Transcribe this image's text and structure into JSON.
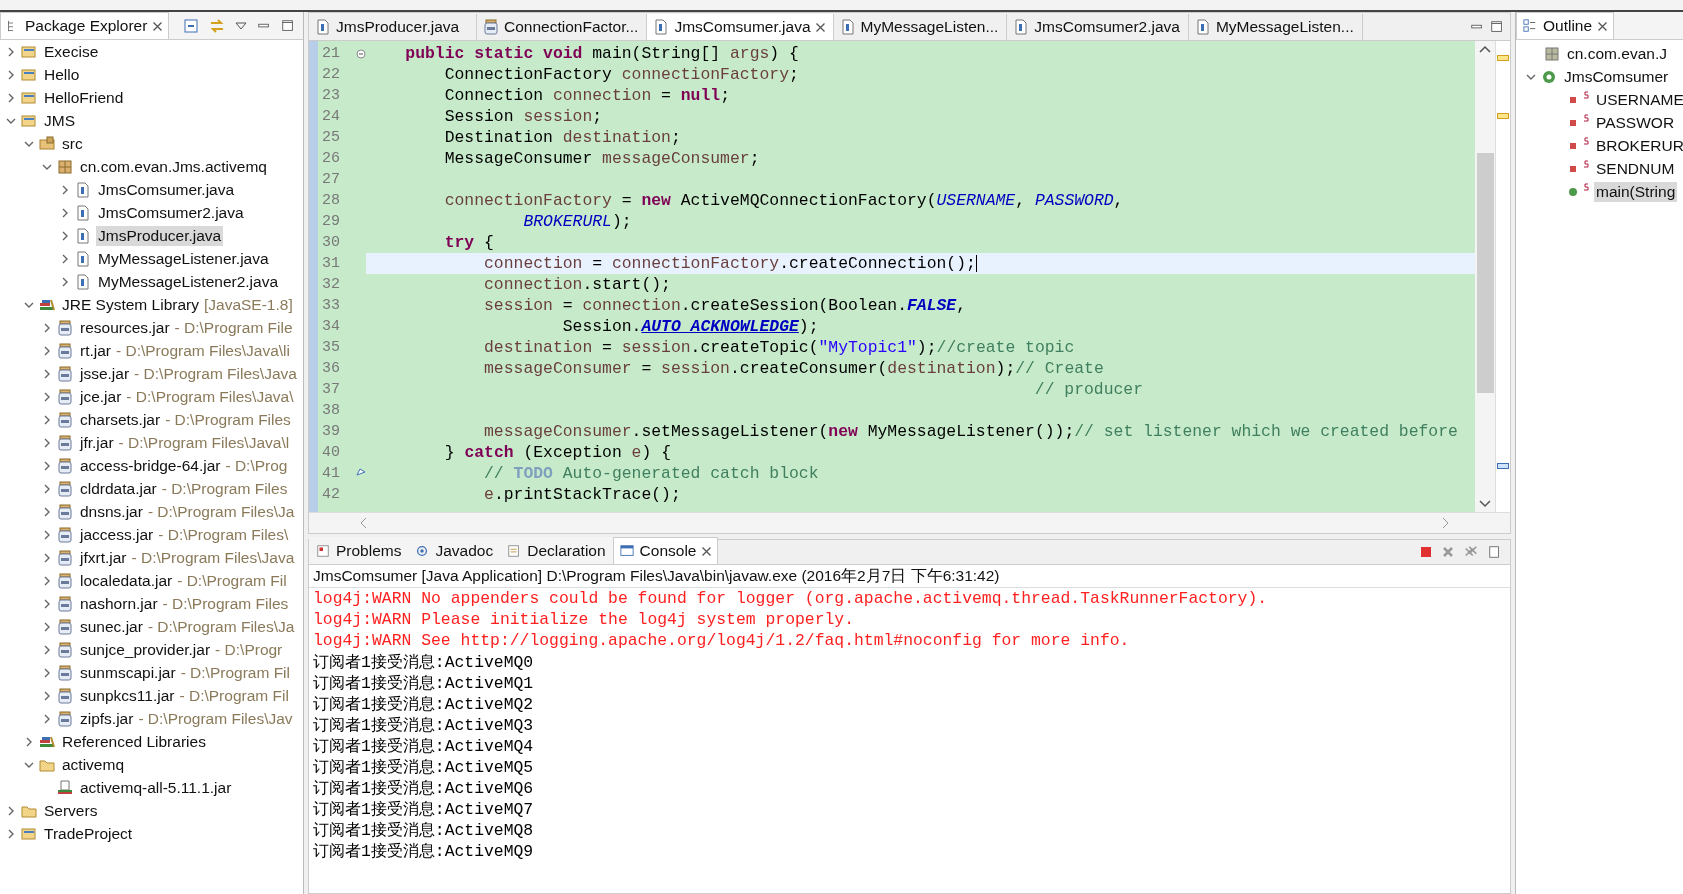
{
  "package_explorer": {
    "title": "Package Explorer",
    "selected": true,
    "tree": [
      {
        "label": "Execise",
        "kind": "project",
        "expanded": false,
        "selected": false
      },
      {
        "label": "Hello",
        "kind": "project",
        "expanded": false,
        "selected": false
      },
      {
        "label": "HelloFriend",
        "kind": "project",
        "expanded": false,
        "selected": false
      },
      {
        "label": "JMS",
        "kind": "project",
        "expanded": true,
        "selected": false,
        "children": [
          {
            "label": "src",
            "kind": "source",
            "expanded": true,
            "selected": false,
            "children": [
              {
                "label": "cn.com.evan.Jms.activemq",
                "kind": "package",
                "expanded": true,
                "selected": false,
                "children": [
                  {
                    "label": "JmsComsumer.java",
                    "kind": "java",
                    "expanded": false,
                    "selected": false
                  },
                  {
                    "label": "JmsComsumer2.java",
                    "kind": "java",
                    "expanded": false,
                    "selected": false
                  },
                  {
                    "label": "JmsProducer.java",
                    "kind": "java",
                    "expanded": false,
                    "selected": true
                  },
                  {
                    "label": "MyMessageListener.java",
                    "kind": "java",
                    "expanded": false,
                    "selected": false
                  },
                  {
                    "label": "MyMessageListener2.java",
                    "kind": "java",
                    "expanded": false,
                    "selected": false
                  }
                ]
              }
            ]
          },
          {
            "label": "JRE System Library",
            "detail": "[JavaSE-1.8]",
            "kind": "library",
            "expanded": true,
            "selected": false,
            "children": [
              {
                "label": "resources.jar",
                "detail": "- D:\\Program File",
                "kind": "jar",
                "expanded": false,
                "selected": false
              },
              {
                "label": "rt.jar",
                "detail": "- D:\\Program Files\\Java\\li",
                "kind": "jar",
                "expanded": false,
                "selected": false
              },
              {
                "label": "jsse.jar",
                "detail": "- D:\\Program Files\\Java",
                "kind": "jar",
                "expanded": false,
                "selected": false
              },
              {
                "label": "jce.jar",
                "detail": "- D:\\Program Files\\Java\\",
                "kind": "jar",
                "expanded": false,
                "selected": false
              },
              {
                "label": "charsets.jar",
                "detail": "- D:\\Program Files",
                "kind": "jar",
                "expanded": false,
                "selected": false
              },
              {
                "label": "jfr.jar",
                "detail": "- D:\\Program Files\\Java\\l",
                "kind": "jar",
                "expanded": false,
                "selected": false
              },
              {
                "label": "access-bridge-64.jar",
                "detail": "- D:\\Prog",
                "kind": "jar",
                "expanded": false,
                "selected": false
              },
              {
                "label": "cldrdata.jar",
                "detail": "- D:\\Program Files",
                "kind": "jar",
                "expanded": false,
                "selected": false
              },
              {
                "label": "dnsns.jar",
                "detail": "- D:\\Program Files\\Ja",
                "kind": "jar",
                "expanded": false,
                "selected": false
              },
              {
                "label": "jaccess.jar",
                "detail": "- D:\\Program Files\\",
                "kind": "jar",
                "expanded": false,
                "selected": false
              },
              {
                "label": "jfxrt.jar",
                "detail": "- D:\\Program Files\\Java",
                "kind": "jar",
                "expanded": false,
                "selected": false
              },
              {
                "label": "localedata.jar",
                "detail": "- D:\\Program Fil",
                "kind": "jar",
                "expanded": false,
                "selected": false
              },
              {
                "label": "nashorn.jar",
                "detail": "- D:\\Program Files",
                "kind": "jar",
                "expanded": false,
                "selected": false
              },
              {
                "label": "sunec.jar",
                "detail": "- D:\\Program Files\\Ja",
                "kind": "jar",
                "expanded": false,
                "selected": false
              },
              {
                "label": "sunjce_provider.jar",
                "detail": "- D:\\Progr",
                "kind": "jar",
                "expanded": false,
                "selected": false
              },
              {
                "label": "sunmscapi.jar",
                "detail": "- D:\\Program Fil",
                "kind": "jar",
                "expanded": false,
                "selected": false
              },
              {
                "label": "sunpkcs11.jar",
                "detail": "- D:\\Program Fil",
                "kind": "jar",
                "expanded": false,
                "selected": false
              },
              {
                "label": "zipfs.jar",
                "detail": "- D:\\Program Files\\Jav",
                "kind": "jar",
                "expanded": false,
                "selected": false
              }
            ]
          },
          {
            "label": "Referenced Libraries",
            "kind": "library",
            "expanded": false,
            "selected": false
          },
          {
            "label": "activemq",
            "kind": "folder",
            "expanded": true,
            "selected": false,
            "children": [
              {
                "label": "activemq-all-5.11.1.jar",
                "kind": "jarfile",
                "selected": false
              }
            ]
          }
        ]
      },
      {
        "label": "Servers",
        "kind": "folder",
        "expanded": false,
        "selected": false
      },
      {
        "label": "TradeProject",
        "kind": "project",
        "expanded": false,
        "selected": false
      }
    ]
  },
  "editor": {
    "tabs": [
      {
        "label": "JmsProducer.java",
        "kind": "java",
        "selected": false
      },
      {
        "label": "ConnectionFactor...",
        "kind": "jar",
        "selected": false
      },
      {
        "label": "JmsComsumer.java",
        "kind": "java",
        "selected": true
      },
      {
        "label": "MyMessageListen...",
        "kind": "java",
        "selected": false
      },
      {
        "label": "JmsComsumer2.java",
        "kind": "java",
        "selected": false
      },
      {
        "label": "MyMessageListen...",
        "kind": "java",
        "selected": false
      }
    ],
    "lines": [
      {
        "number": "21",
        "current": false,
        "tokens": [
          {
            "kind": "k",
            "text": "    public static void"
          },
          {
            "kind": "p",
            "text": " main(String[] "
          },
          {
            "kind": "v",
            "text": "args"
          },
          {
            "kind": "p",
            "text": ") {"
          }
        ]
      },
      {
        "number": "22",
        "current": false,
        "tokens": [
          {
            "kind": "p",
            "text": "        ConnectionFactory "
          },
          {
            "kind": "v",
            "text": "connectionFactory"
          },
          {
            "kind": "p",
            "text": ";"
          }
        ]
      },
      {
        "number": "23",
        "current": false,
        "tokens": [
          {
            "kind": "p",
            "text": "        Connection "
          },
          {
            "kind": "v",
            "text": "connection"
          },
          {
            "kind": "p",
            "text": " = "
          },
          {
            "kind": "k",
            "text": "null"
          },
          {
            "kind": "p",
            "text": ";"
          }
        ]
      },
      {
        "number": "24",
        "current": false,
        "tokens": [
          {
            "kind": "p",
            "text": "        Session "
          },
          {
            "kind": "v",
            "text": "session"
          },
          {
            "kind": "p",
            "text": ";"
          }
        ]
      },
      {
        "number": "25",
        "current": false,
        "tokens": [
          {
            "kind": "p",
            "text": "        Destination "
          },
          {
            "kind": "v",
            "text": "destination"
          },
          {
            "kind": "p",
            "text": ";"
          }
        ]
      },
      {
        "number": "26",
        "current": false,
        "tokens": [
          {
            "kind": "p",
            "text": "        MessageConsumer "
          },
          {
            "kind": "v",
            "text": "messageConsumer"
          },
          {
            "kind": "p",
            "text": ";"
          }
        ]
      },
      {
        "number": "27",
        "current": false
      },
      {
        "number": "28",
        "current": false,
        "tokens": [
          {
            "kind": "v",
            "text": "        connectionFactory"
          },
          {
            "kind": "p",
            "text": " = "
          },
          {
            "kind": "k",
            "text": "new"
          },
          {
            "kind": "p",
            "text": " ActiveMQConnectionFactory("
          },
          {
            "kind": "s",
            "text": "USERNAME"
          },
          {
            "kind": "p",
            "text": ", "
          },
          {
            "kind": "s",
            "text": "PASSWORD"
          },
          {
            "kind": "p",
            "text": ","
          }
        ]
      },
      {
        "number": "29",
        "current": false,
        "tokens": [
          {
            "kind": "s",
            "text": "                BROKERURL"
          },
          {
            "kind": "p",
            "text": ");"
          }
        ]
      },
      {
        "number": "30",
        "current": false,
        "tokens": [
          {
            "kind": "k",
            "text": "        try"
          },
          {
            "kind": "p",
            "text": " {"
          }
        ]
      },
      {
        "number": "31",
        "current": true,
        "tokens": [
          {
            "kind": "v",
            "text": "            connection"
          },
          {
            "kind": "p",
            "text": " = "
          },
          {
            "kind": "v",
            "text": "connectionFactory"
          },
          {
            "kind": "p",
            "text": ".createConnection();"
          }
        ]
      },
      {
        "number": "32",
        "current": false,
        "tokens": [
          {
            "kind": "v",
            "text": "            connection"
          },
          {
            "kind": "p",
            "text": ".start();"
          }
        ]
      },
      {
        "number": "33",
        "current": false,
        "tokens": [
          {
            "kind": "v",
            "text": "            session"
          },
          {
            "kind": "p",
            "text": " = "
          },
          {
            "kind": "v",
            "text": "connection"
          },
          {
            "kind": "p",
            "text": ".createSession(Boolean."
          },
          {
            "kind": "c",
            "text": "FALSE"
          },
          {
            "kind": "p",
            "text": ","
          }
        ]
      },
      {
        "number": "34",
        "current": false,
        "tokens": [
          {
            "kind": "p",
            "text": "                    Session."
          },
          {
            "kind": "cu",
            "text": "AUTO_ACKNOWLEDGE"
          },
          {
            "kind": "p",
            "text": ");"
          }
        ]
      },
      {
        "number": "35",
        "current": false,
        "tokens": [
          {
            "kind": "v",
            "text": "            destination"
          },
          {
            "kind": "p",
            "text": " = "
          },
          {
            "kind": "v",
            "text": "session"
          },
          {
            "kind": "p",
            "text": ".createTopic("
          },
          {
            "kind": "str",
            "text": "\"MyTopic1\""
          },
          {
            "kind": "p",
            "text": ");"
          },
          {
            "kind": "cm",
            "text": "//create topic"
          }
        ]
      },
      {
        "number": "36",
        "current": false,
        "tokens": [
          {
            "kind": "v",
            "text": "            messageConsumer"
          },
          {
            "kind": "p",
            "text": " = "
          },
          {
            "kind": "v",
            "text": "session"
          },
          {
            "kind": "p",
            "text": ".createConsumer("
          },
          {
            "kind": "v",
            "text": "destination"
          },
          {
            "kind": "p",
            "text": ");"
          },
          {
            "kind": "cm",
            "text": "// Create"
          }
        ]
      },
      {
        "number": "37",
        "current": false,
        "tokens": [
          {
            "kind": "cm",
            "text": "                                                                    // producer"
          }
        ]
      },
      {
        "number": "38",
        "current": false
      },
      {
        "number": "39",
        "current": false,
        "tokens": [
          {
            "kind": "v",
            "text": "            messageConsumer"
          },
          {
            "kind": "p",
            "text": ".setMessageListener("
          },
          {
            "kind": "k",
            "text": "new"
          },
          {
            "kind": "p",
            "text": " MyMessageListener());"
          },
          {
            "kind": "cm",
            "text": "// set listener which we created before"
          }
        ]
      },
      {
        "number": "40",
        "current": false,
        "tokens": [
          {
            "kind": "p",
            "text": "        } "
          },
          {
            "kind": "k",
            "text": "catch"
          },
          {
            "kind": "p",
            "text": " (Exception "
          },
          {
            "kind": "v",
            "text": "e"
          },
          {
            "kind": "p",
            "text": ") {"
          }
        ]
      },
      {
        "number": "41",
        "current": false,
        "task": true,
        "tokens": [
          {
            "kind": "cm",
            "text": "            // "
          },
          {
            "kind": "todo",
            "text": "TODO"
          },
          {
            "kind": "cm",
            "text": " Auto-generated catch block"
          }
        ]
      },
      {
        "number": "42",
        "current": false,
        "tokens": [
          {
            "kind": "v",
            "text": "            e"
          },
          {
            "kind": "p",
            "text": ".printStackTrace();"
          }
        ]
      }
    ]
  },
  "outline": {
    "title": "Outline",
    "items": [
      {
        "label": "cn.com.evan.J",
        "kind": "package",
        "selected": false
      },
      {
        "label": "JmsComsumer",
        "kind": "class",
        "selected": false
      },
      {
        "label": "USERNAME",
        "kind": "field",
        "selected": false
      },
      {
        "label": "PASSWOR",
        "kind": "field",
        "selected": false
      },
      {
        "label": "BROKERUR",
        "kind": "field",
        "selected": false
      },
      {
        "label": "SENDNUM",
        "kind": "field",
        "selected": false
      },
      {
        "label": "main(String",
        "kind": "method",
        "selected": true
      }
    ]
  },
  "console": {
    "tabs": [
      {
        "label": "Problems",
        "kind": "problems",
        "selected": false
      },
      {
        "label": "Javadoc",
        "kind": "javadoc",
        "selected": false
      },
      {
        "label": "Declaration",
        "kind": "declaration",
        "selected": false
      },
      {
        "label": "Console",
        "kind": "console",
        "selected": true
      }
    ],
    "header": "JmsComsumer [Java Application] D:\\Program Files\\Java\\bin\\javaw.exe (2016年2月7日 下午6:31:42)",
    "output": [
      {
        "kind": "error",
        "text": "log4j:WARN No appenders could be found for logger (org.apache.activemq.thread.TaskRunnerFactory)."
      },
      {
        "kind": "error",
        "text": "log4j:WARN Please initialize the log4j system properly."
      },
      {
        "kind": "error",
        "text": "log4j:WARN See http://logging.apache.org/log4j/1.2/faq.html#noconfig for more info."
      },
      {
        "kind": "out",
        "text": "订阅者1接受消息:ActiveMQ0"
      },
      {
        "kind": "out",
        "text": "订阅者1接受消息:ActiveMQ1"
      },
      {
        "kind": "out",
        "text": "订阅者1接受消息:ActiveMQ2"
      },
      {
        "kind": "out",
        "text": "订阅者1接受消息:ActiveMQ3"
      },
      {
        "kind": "out",
        "text": "订阅者1接受消息:ActiveMQ4"
      },
      {
        "kind": "out",
        "text": "订阅者1接受消息:ActiveMQ5"
      },
      {
        "kind": "out",
        "text": "订阅者1接受消息:ActiveMQ6"
      },
      {
        "kind": "out",
        "text": "订阅者1接受消息:ActiveMQ7"
      },
      {
        "kind": "out",
        "text": "订阅者1接受消息:ActiveMQ8"
      },
      {
        "kind": "out",
        "text": "订阅者1接受消息:ActiveMQ9"
      }
    ]
  }
}
